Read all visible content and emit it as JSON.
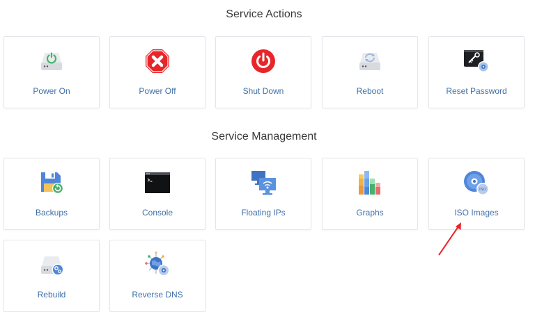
{
  "service_actions": {
    "title": "Service Actions",
    "items": [
      {
        "label": "Power On",
        "icon": "power-on-icon"
      },
      {
        "label": "Power Off",
        "icon": "power-off-icon"
      },
      {
        "label": "Shut Down",
        "icon": "shut-down-icon"
      },
      {
        "label": "Reboot",
        "icon": "reboot-icon"
      },
      {
        "label": "Reset Password",
        "icon": "reset-password-icon"
      }
    ]
  },
  "service_management": {
    "title": "Service Management",
    "items": [
      {
        "label": "Backups",
        "icon": "backups-icon"
      },
      {
        "label": "Console",
        "icon": "console-icon"
      },
      {
        "label": "Floating IPs",
        "icon": "floating-ips-icon"
      },
      {
        "label": "Graphs",
        "icon": "graphs-icon"
      },
      {
        "label": "ISO Images",
        "icon": "iso-images-icon",
        "badge": "ISO"
      },
      {
        "label": "Rebuild",
        "icon": "rebuild-icon"
      },
      {
        "label": "Reverse DNS",
        "icon": "reverse-dns-icon"
      }
    ]
  },
  "colors": {
    "label_blue": "#3e6fa6",
    "red": "#e8262a",
    "green": "#46b26b",
    "annotation_arrow": "#e8262a"
  }
}
